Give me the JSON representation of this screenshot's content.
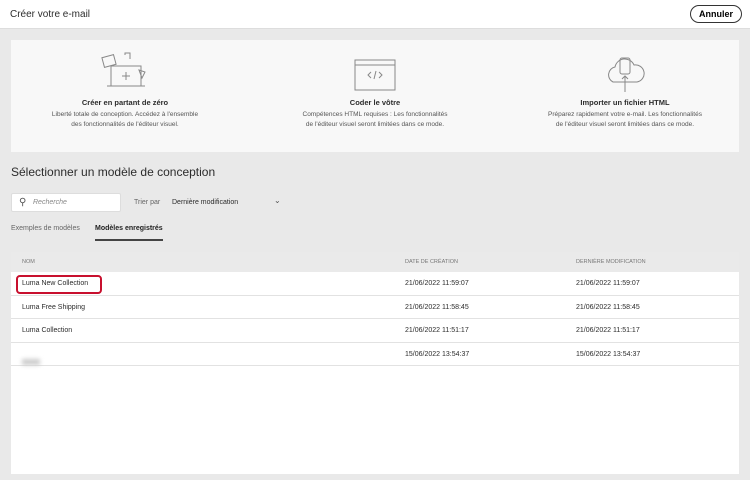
{
  "header": {
    "title": "Créer votre e-mail",
    "cancel": "Annuler"
  },
  "options": [
    {
      "icon": "design-from-scratch-icon",
      "title": "Créer en partant de zéro",
      "desc1": "Liberté totale de conception. Accédez à l'ensemble",
      "desc2": "des fonctionnalités de l'éditeur visuel."
    },
    {
      "icon": "code-icon",
      "title": "Coder le vôtre",
      "desc1": "Compétences HTML requises : Les fonctionnalités",
      "desc2": "de l'éditeur visuel seront limitées dans ce mode."
    },
    {
      "icon": "cloud-upload-icon",
      "title": "Importer un fichier HTML",
      "desc1": "Préparez rapidement votre e-mail. Les fonctionnalités",
      "desc2": "de l'éditeur visuel seront limitées dans ce mode."
    }
  ],
  "section_title": "Sélectionner un modèle de conception",
  "search": {
    "placeholder": "Recherche"
  },
  "sort": {
    "label": "Trier par",
    "value": "Dernière modification"
  },
  "tabs": [
    "Exemples de modèles",
    "Modèles enregistrés"
  ],
  "table": {
    "headers": [
      "NOM",
      "DATE DE CRÉATION",
      "DERNIÈRE MODIFICATION"
    ],
    "rows": [
      {
        "name": "Luma New Collection",
        "created": "21/06/2022 11:59:07",
        "modified": "21/06/2022 11:59:07"
      },
      {
        "name": "Luma Free Shipping",
        "created": "21/06/2022 11:58:45",
        "modified": "21/06/2022 11:58:45"
      },
      {
        "name": "Luma Collection",
        "created": "21/06/2022 11:51:17",
        "modified": "21/06/2022 11:51:17"
      },
      {
        "name": null,
        "created": "15/06/2022 13:54:37",
        "modified": "15/06/2022 13:54:37"
      }
    ]
  }
}
